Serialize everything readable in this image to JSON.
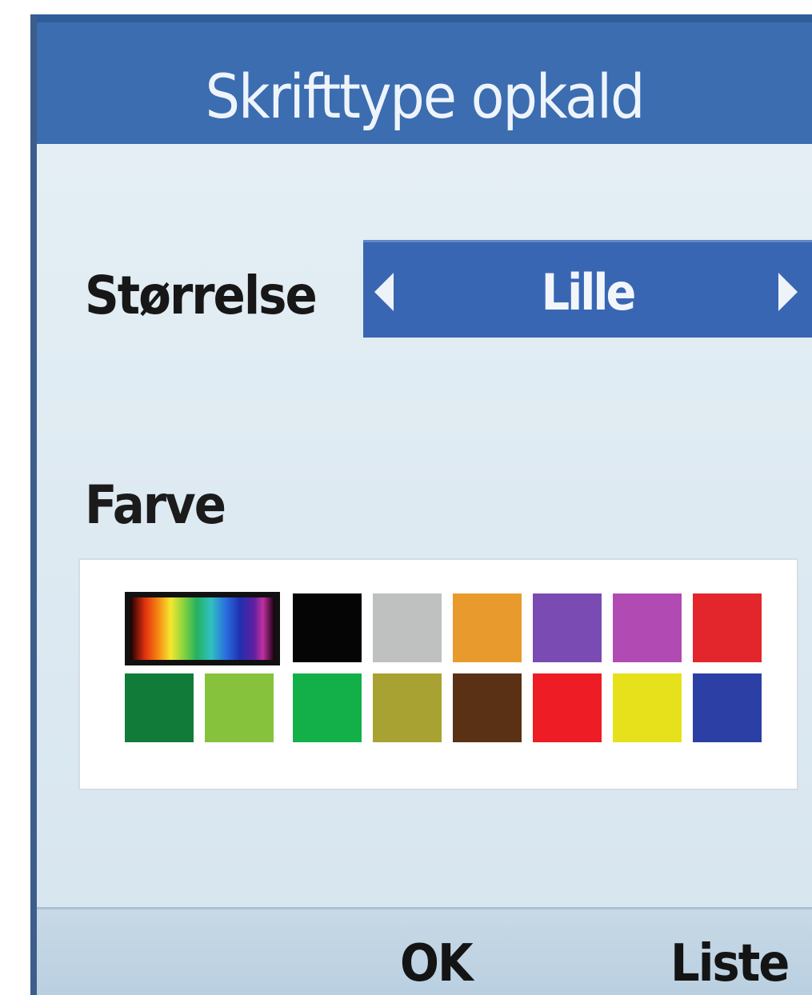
{
  "dialog": {
    "title": "Skrifttype opkald"
  },
  "size_setting": {
    "label": "Størrelse",
    "value": "Lille"
  },
  "color_setting": {
    "label": "Farve",
    "swatches": [
      {
        "name": "rainbow",
        "selected": true
      },
      {
        "name": "black",
        "color": "#050505"
      },
      {
        "name": "grey",
        "color": "#bfc0c0"
      },
      {
        "name": "orange",
        "color": "#e99a2c"
      },
      {
        "name": "violet",
        "color": "#7a4bb2"
      },
      {
        "name": "magenta",
        "color": "#b14bb3"
      },
      {
        "name": "red",
        "color": "#e2262c"
      },
      {
        "name": "dark-green",
        "color": "#117c3a"
      },
      {
        "name": "light-green",
        "color": "#86c23b"
      },
      {
        "name": "green",
        "color": "#13b04a"
      },
      {
        "name": "olive",
        "color": "#a8a232"
      },
      {
        "name": "brown",
        "color": "#5a3115"
      },
      {
        "name": "bright-red",
        "color": "#ee1c24"
      },
      {
        "name": "yellow",
        "color": "#e6e11b"
      },
      {
        "name": "blue",
        "color": "#2c3fa5"
      }
    ]
  },
  "softkeys": {
    "ok": "OK",
    "list": "Liste"
  }
}
